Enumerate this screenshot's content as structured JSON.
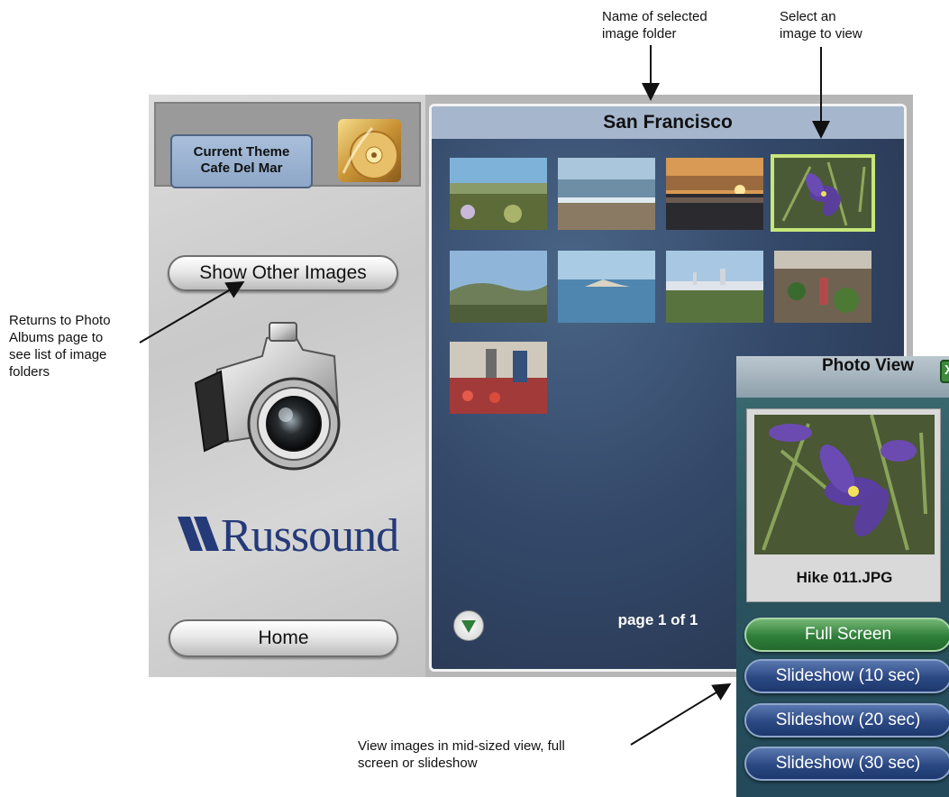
{
  "annotations": {
    "folder_name_line1": "Name of selected",
    "folder_name_line2": "image folder",
    "select_line1": "Select an",
    "select_line2": "image to view",
    "returns_line1": "Returns to Photo",
    "returns_line2": "Albums page to",
    "returns_line3": "see list of image",
    "returns_line4": "folders",
    "view_line1": "View images in mid-sized view, full",
    "view_line2": "screen or slideshow"
  },
  "theme": {
    "line1": "Current Theme",
    "line2": "Cafe Del Mar"
  },
  "left_panel": {
    "show_other_label": "Show Other Images",
    "home_label": "Home",
    "brand": "Russound"
  },
  "gallery": {
    "folder_title": "San Francisco",
    "page_indicator": "page 1 of 1",
    "thumbnail_count": 9,
    "selected_index": 3
  },
  "photo_view": {
    "title": "Photo View",
    "close_glyph": "X",
    "filename": "Hike 011.JPG",
    "buttons": {
      "full_screen": "Full Screen",
      "slideshow_10": "Slideshow (10 sec)",
      "slideshow_20": "Slideshow (20 sec)",
      "slideshow_30": "Slideshow (30 sec)"
    }
  },
  "colors": {
    "title_bar": "#a6b7cd",
    "selection_border": "#c6e77a",
    "full_screen_button": "#2f7e3a",
    "slideshow_button": "#2b4882",
    "brand": "#253a78"
  }
}
